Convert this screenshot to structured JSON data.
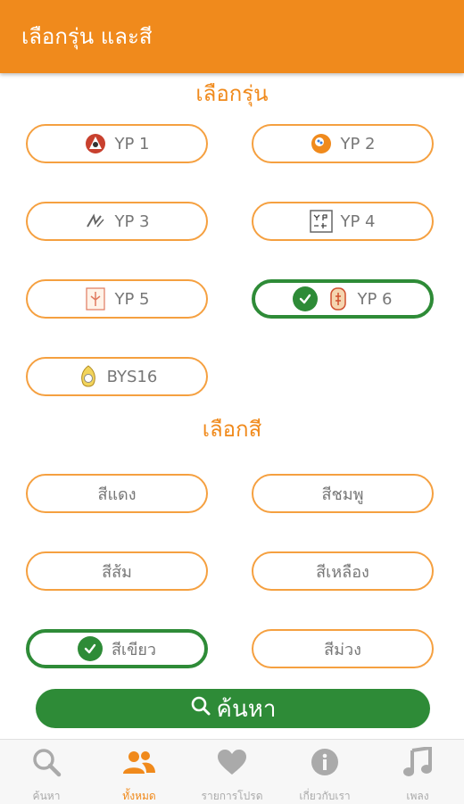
{
  "header": {
    "title": "เลือกรุ่น และสี"
  },
  "models_section": {
    "title": "เลือกรุ่น",
    "items": [
      {
        "label": "YP 1",
        "selected": false,
        "icon": "yp1-logo-icon"
      },
      {
        "label": "YP 2",
        "selected": false,
        "icon": "yp2-logo-icon"
      },
      {
        "label": "YP 3",
        "selected": false,
        "icon": "yp3-logo-icon"
      },
      {
        "label": "YP 4",
        "selected": false,
        "icon": "yp4-logo-icon"
      },
      {
        "label": "YP 5",
        "selected": false,
        "icon": "yp5-logo-icon"
      },
      {
        "label": "YP 6",
        "selected": true,
        "icon": "yp6-logo-icon"
      },
      {
        "label": "BYS16",
        "selected": false,
        "icon": "bys16-logo-icon"
      }
    ]
  },
  "colors_section": {
    "title": "เลือกสี",
    "items": [
      {
        "label": "สีแดง",
        "selected": false
      },
      {
        "label": "สีชมพู",
        "selected": false
      },
      {
        "label": "สีส้ม",
        "selected": false
      },
      {
        "label": "สีเหลือง",
        "selected": false
      },
      {
        "label": "สีเขียว",
        "selected": true
      },
      {
        "label": "สีม่วง",
        "selected": false
      }
    ]
  },
  "search_button": {
    "label": "ค้นหา",
    "icon": "search-icon"
  },
  "tabbar": {
    "active_index": 1,
    "tabs": [
      {
        "label": "ค้นหา",
        "icon": "search-icon"
      },
      {
        "label": "ทั้งหมด",
        "icon": "people-icon"
      },
      {
        "label": "รายการโปรด",
        "icon": "heart-icon"
      },
      {
        "label": "เกี่ยวกับเรา",
        "icon": "info-icon"
      },
      {
        "label": "เพลง",
        "icon": "music-note-icon"
      }
    ]
  },
  "colors": {
    "accent": "#F08A1C",
    "selected": "#2E8B37",
    "pill_border": "#F5A040",
    "inactive": "#AAAAAA"
  }
}
